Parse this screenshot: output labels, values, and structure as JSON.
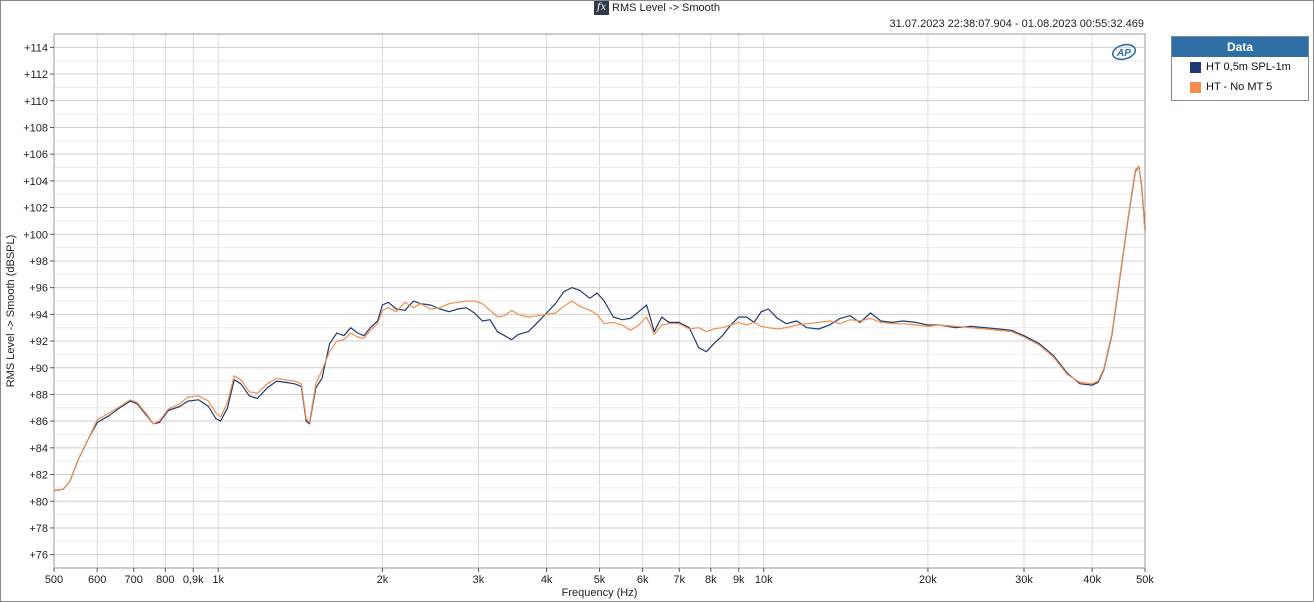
{
  "header": {
    "icon": "fx-icon",
    "title": "RMS Level -> Smooth",
    "timestamp": "31.07.2023 22:38:07.904 - 01.08.2023 00:55:32.469"
  },
  "legend": {
    "header": "Data",
    "items": [
      {
        "label": "HT 0,5m SPL-1m",
        "color": "#1f3a73"
      },
      {
        "label": "HT - No MT  5",
        "color": "#f28e4c"
      }
    ]
  },
  "logo": {
    "icon": "ap-logo-icon",
    "text": "AP",
    "color": "#2f6fa6"
  },
  "chart_data": {
    "type": "line",
    "xlabel": "Frequency (Hz)",
    "ylabel": "RMS Level -> Smooth (dBSPL)",
    "xscale": "log",
    "xlim": [
      500,
      50000
    ],
    "ylim": [
      75,
      115
    ],
    "grid": true,
    "legend_position": "right",
    "x_ticks": [
      {
        "v": 500,
        "label": "500"
      },
      {
        "v": 600,
        "label": "600"
      },
      {
        "v": 700,
        "label": "700"
      },
      {
        "v": 800,
        "label": "800"
      },
      {
        "v": 900,
        "label": "0,9k"
      },
      {
        "v": 1000,
        "label": "1k"
      },
      {
        "v": 2000,
        "label": "2k"
      },
      {
        "v": 3000,
        "label": "3k"
      },
      {
        "v": 4000,
        "label": "4k"
      },
      {
        "v": 5000,
        "label": "5k"
      },
      {
        "v": 6000,
        "label": "6k"
      },
      {
        "v": 7000,
        "label": "7k"
      },
      {
        "v": 8000,
        "label": "8k"
      },
      {
        "v": 9000,
        "label": "9k"
      },
      {
        "v": 10000,
        "label": "10k"
      },
      {
        "v": 20000,
        "label": "20k"
      },
      {
        "v": 30000,
        "label": "30k"
      },
      {
        "v": 40000,
        "label": "40k"
      },
      {
        "v": 50000,
        "label": "50k"
      }
    ],
    "y_ticks": [
      {
        "v": 76,
        "label": "+76"
      },
      {
        "v": 78,
        "label": "+78"
      },
      {
        "v": 80,
        "label": "+80"
      },
      {
        "v": 82,
        "label": "+82"
      },
      {
        "v": 84,
        "label": "+84"
      },
      {
        "v": 86,
        "label": "+86"
      },
      {
        "v": 88,
        "label": "+88"
      },
      {
        "v": 90,
        "label": "+90"
      },
      {
        "v": 92,
        "label": "+92"
      },
      {
        "v": 94,
        "label": "+94"
      },
      {
        "v": 96,
        "label": "+96"
      },
      {
        "v": 98,
        "label": "+98"
      },
      {
        "v": 100,
        "label": "+100"
      },
      {
        "v": 102,
        "label": "+102"
      },
      {
        "v": 104,
        "label": "+104"
      },
      {
        "v": 106,
        "label": "+106"
      },
      {
        "v": 108,
        "label": "+108"
      },
      {
        "v": 110,
        "label": "+110"
      },
      {
        "v": 112,
        "label": "+112"
      },
      {
        "v": 114,
        "label": "+114"
      }
    ],
    "series": [
      {
        "name": "HT 0,5m SPL-1m",
        "color": "#1f3a73",
        "points": [
          [
            500,
            80.8
          ],
          [
            520,
            80.9
          ],
          [
            535,
            81.5
          ],
          [
            555,
            83.2
          ],
          [
            580,
            84.8
          ],
          [
            600,
            85.9
          ],
          [
            630,
            86.4
          ],
          [
            660,
            87.0
          ],
          [
            690,
            87.5
          ],
          [
            710,
            87.3
          ],
          [
            740,
            86.4
          ],
          [
            760,
            85.8
          ],
          [
            780,
            85.9
          ],
          [
            810,
            86.8
          ],
          [
            850,
            87.1
          ],
          [
            880,
            87.5
          ],
          [
            920,
            87.6
          ],
          [
            960,
            87.1
          ],
          [
            990,
            86.2
          ],
          [
            1010,
            86.0
          ],
          [
            1040,
            87.0
          ],
          [
            1070,
            89.1
          ],
          [
            1100,
            88.8
          ],
          [
            1140,
            87.9
          ],
          [
            1180,
            87.7
          ],
          [
            1230,
            88.5
          ],
          [
            1280,
            89.0
          ],
          [
            1330,
            88.9
          ],
          [
            1380,
            88.8
          ],
          [
            1420,
            88.6
          ],
          [
            1450,
            86.0
          ],
          [
            1470,
            85.8
          ],
          [
            1510,
            88.5
          ],
          [
            1550,
            89.2
          ],
          [
            1600,
            91.8
          ],
          [
            1650,
            92.6
          ],
          [
            1700,
            92.4
          ],
          [
            1750,
            93.0
          ],
          [
            1800,
            92.6
          ],
          [
            1850,
            92.4
          ],
          [
            1900,
            93.0
          ],
          [
            1960,
            93.5
          ],
          [
            2000,
            94.7
          ],
          [
            2050,
            94.9
          ],
          [
            2120,
            94.4
          ],
          [
            2200,
            94.3
          ],
          [
            2280,
            95.0
          ],
          [
            2350,
            94.8
          ],
          [
            2450,
            94.7
          ],
          [
            2550,
            94.4
          ],
          [
            2650,
            94.2
          ],
          [
            2750,
            94.4
          ],
          [
            2850,
            94.5
          ],
          [
            2950,
            94.1
          ],
          [
            3050,
            93.5
          ],
          [
            3150,
            93.6
          ],
          [
            3250,
            92.7
          ],
          [
            3350,
            92.4
          ],
          [
            3450,
            92.1
          ],
          [
            3550,
            92.5
          ],
          [
            3700,
            92.7
          ],
          [
            3850,
            93.4
          ],
          [
            4000,
            94.1
          ],
          [
            4150,
            94.8
          ],
          [
            4300,
            95.7
          ],
          [
            4450,
            96.0
          ],
          [
            4600,
            95.8
          ],
          [
            4800,
            95.2
          ],
          [
            4950,
            95.6
          ],
          [
            5100,
            95.0
          ],
          [
            5300,
            93.8
          ],
          [
            5500,
            93.6
          ],
          [
            5700,
            93.7
          ],
          [
            5900,
            94.2
          ],
          [
            6100,
            94.7
          ],
          [
            6300,
            92.7
          ],
          [
            6500,
            93.8
          ],
          [
            6700,
            93.4
          ],
          [
            7000,
            93.4
          ],
          [
            7300,
            93.0
          ],
          [
            7600,
            91.5
          ],
          [
            7850,
            91.2
          ],
          [
            8100,
            91.8
          ],
          [
            8400,
            92.4
          ],
          [
            8700,
            93.2
          ],
          [
            9000,
            93.8
          ],
          [
            9300,
            93.8
          ],
          [
            9600,
            93.4
          ],
          [
            9900,
            94.2
          ],
          [
            10200,
            94.4
          ],
          [
            10600,
            93.7
          ],
          [
            11000,
            93.3
          ],
          [
            11500,
            93.5
          ],
          [
            12000,
            93.0
          ],
          [
            12600,
            92.9
          ],
          [
            13200,
            93.2
          ],
          [
            13800,
            93.7
          ],
          [
            14400,
            93.9
          ],
          [
            15000,
            93.4
          ],
          [
            15700,
            94.1
          ],
          [
            16400,
            93.5
          ],
          [
            17200,
            93.4
          ],
          [
            18000,
            93.5
          ],
          [
            19000,
            93.4
          ],
          [
            20000,
            93.2
          ],
          [
            21000,
            93.2
          ],
          [
            22500,
            93.0
          ],
          [
            24000,
            93.1
          ],
          [
            25500,
            93.0
          ],
          [
            27000,
            92.9
          ],
          [
            28500,
            92.8
          ],
          [
            30000,
            92.4
          ],
          [
            32000,
            91.8
          ],
          [
            34000,
            90.9
          ],
          [
            36000,
            89.6
          ],
          [
            38000,
            88.8
          ],
          [
            40000,
            88.7
          ],
          [
            41000,
            88.9
          ],
          [
            42000,
            89.8
          ],
          [
            43500,
            92.5
          ],
          [
            45000,
            96.8
          ],
          [
            46500,
            101.0
          ],
          [
            48000,
            104.7
          ],
          [
            48700,
            105.1
          ],
          [
            49300,
            103.6
          ],
          [
            50000,
            100.3
          ]
        ]
      },
      {
        "name": "HT - No MT  5",
        "color": "#f28e4c",
        "points": [
          [
            500,
            80.8
          ],
          [
            520,
            80.9
          ],
          [
            535,
            81.5
          ],
          [
            555,
            83.2
          ],
          [
            580,
            84.8
          ],
          [
            600,
            86.1
          ],
          [
            630,
            86.6
          ],
          [
            660,
            87.1
          ],
          [
            690,
            87.6
          ],
          [
            710,
            87.4
          ],
          [
            740,
            86.5
          ],
          [
            760,
            85.8
          ],
          [
            780,
            86.0
          ],
          [
            810,
            86.9
          ],
          [
            850,
            87.3
          ],
          [
            880,
            87.8
          ],
          [
            920,
            87.9
          ],
          [
            960,
            87.5
          ],
          [
            990,
            86.6
          ],
          [
            1010,
            86.3
          ],
          [
            1040,
            87.4
          ],
          [
            1070,
            89.4
          ],
          [
            1100,
            89.1
          ],
          [
            1140,
            88.2
          ],
          [
            1180,
            88.1
          ],
          [
            1230,
            88.8
          ],
          [
            1280,
            89.2
          ],
          [
            1330,
            89.1
          ],
          [
            1380,
            89.0
          ],
          [
            1420,
            88.8
          ],
          [
            1450,
            86.2
          ],
          [
            1470,
            85.9
          ],
          [
            1510,
            88.8
          ],
          [
            1550,
            89.8
          ],
          [
            1600,
            91.2
          ],
          [
            1650,
            92.0
          ],
          [
            1700,
            92.1
          ],
          [
            1750,
            92.6
          ],
          [
            1800,
            92.3
          ],
          [
            1850,
            92.2
          ],
          [
            1900,
            92.8
          ],
          [
            1960,
            93.3
          ],
          [
            2000,
            94.3
          ],
          [
            2050,
            94.5
          ],
          [
            2120,
            94.2
          ],
          [
            2200,
            94.9
          ],
          [
            2280,
            94.5
          ],
          [
            2350,
            94.8
          ],
          [
            2450,
            94.4
          ],
          [
            2550,
            94.5
          ],
          [
            2650,
            94.8
          ],
          [
            2750,
            94.9
          ],
          [
            2850,
            95.0
          ],
          [
            2950,
            95.0
          ],
          [
            3050,
            94.8
          ],
          [
            3150,
            94.3
          ],
          [
            3250,
            93.8
          ],
          [
            3350,
            93.9
          ],
          [
            3450,
            94.3
          ],
          [
            3550,
            94.0
          ],
          [
            3700,
            93.8
          ],
          [
            3850,
            93.9
          ],
          [
            4000,
            94.0
          ],
          [
            4150,
            94.1
          ],
          [
            4300,
            94.6
          ],
          [
            4450,
            95.0
          ],
          [
            4600,
            94.6
          ],
          [
            4800,
            94.3
          ],
          [
            4950,
            94.0
          ],
          [
            5100,
            93.3
          ],
          [
            5300,
            93.4
          ],
          [
            5500,
            93.2
          ],
          [
            5700,
            92.8
          ],
          [
            5900,
            93.2
          ],
          [
            6100,
            93.8
          ],
          [
            6300,
            92.5
          ],
          [
            6500,
            93.2
          ],
          [
            6700,
            93.3
          ],
          [
            7000,
            93.3
          ],
          [
            7300,
            92.9
          ],
          [
            7600,
            93.0
          ],
          [
            7850,
            92.7
          ],
          [
            8100,
            92.9
          ],
          [
            8400,
            93.0
          ],
          [
            8700,
            93.2
          ],
          [
            9000,
            93.4
          ],
          [
            9300,
            93.2
          ],
          [
            9600,
            93.4
          ],
          [
            9900,
            93.1
          ],
          [
            10200,
            93.0
          ],
          [
            10600,
            92.9
          ],
          [
            11000,
            93.0
          ],
          [
            11500,
            93.2
          ],
          [
            12000,
            93.3
          ],
          [
            12600,
            93.4
          ],
          [
            13200,
            93.5
          ],
          [
            13800,
            93.3
          ],
          [
            14400,
            93.6
          ],
          [
            15000,
            93.5
          ],
          [
            15700,
            93.7
          ],
          [
            16400,
            93.4
          ],
          [
            17200,
            93.3
          ],
          [
            18000,
            93.3
          ],
          [
            19000,
            93.2
          ],
          [
            20000,
            93.1
          ],
          [
            21000,
            93.2
          ],
          [
            22500,
            93.1
          ],
          [
            24000,
            93.0
          ],
          [
            25500,
            92.9
          ],
          [
            27000,
            92.8
          ],
          [
            28500,
            92.7
          ],
          [
            30000,
            92.3
          ],
          [
            32000,
            91.7
          ],
          [
            34000,
            90.8
          ],
          [
            36000,
            89.5
          ],
          [
            38000,
            88.9
          ],
          [
            40000,
            88.8
          ],
          [
            41000,
            89.0
          ],
          [
            42000,
            89.9
          ],
          [
            43500,
            92.6
          ],
          [
            45000,
            96.9
          ],
          [
            46500,
            101.1
          ],
          [
            48000,
            104.8
          ],
          [
            48700,
            105.1
          ],
          [
            49300,
            103.5
          ],
          [
            50000,
            100.1
          ]
        ]
      }
    ]
  }
}
